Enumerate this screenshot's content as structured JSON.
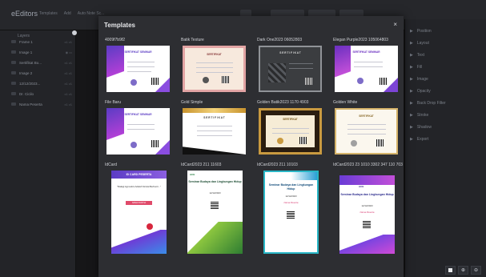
{
  "app": {
    "brand": "eEditors",
    "menu": [
      "Templates",
      "Add",
      "Auto Note Sc..."
    ]
  },
  "left_panel": {
    "title": "Layers",
    "layers": [
      {
        "label": "Frame 1",
        "meta": "x1  v1"
      },
      {
        "label": "Image 1",
        "meta": "◉  ▭"
      },
      {
        "label": "Sertifikat Bo...",
        "meta": "x1  v1"
      },
      {
        "label": "Image 2",
        "meta": "x1  v1"
      },
      {
        "label": "12/12/2023...",
        "meta": "x1  v1"
      },
      {
        "label": "Dr. Cicilo",
        "meta": "x1  v1"
      },
      {
        "label": "Nama Peserta",
        "meta": "x1  v1"
      }
    ]
  },
  "right_panel": {
    "items": [
      "Position",
      "Layout",
      "Text",
      "Fill",
      "Image",
      "Opacity",
      "Back Drop Filter",
      "Stroke",
      "Shadow",
      "Export"
    ]
  },
  "dialog": {
    "title": "Templates",
    "close_icon": "×",
    "templates": [
      {
        "name": "4009f7b9f2"
      },
      {
        "name": "Batik Texture"
      },
      {
        "name": "Dark One2023 06052803"
      },
      {
        "name": "Elegan Purple2023 105064803"
      },
      {
        "name": "File Baru"
      },
      {
        "name": "Gold Simple"
      },
      {
        "name": "Golden Batik2023 1170 4903"
      },
      {
        "name": "Golden White"
      },
      {
        "name": "IdCard"
      },
      {
        "name": "IdCard2023 211 11603"
      },
      {
        "name": "IdCard2023 211 10103"
      },
      {
        "name": "IdCard2023 23 1010 3302 347 110 703"
      }
    ],
    "cert_texts": {
      "sertifikat_seminar": "SERTIFIKAT SEMINAR",
      "sertifikat": "SERTIFIKAT",
      "sertifikat_spaced": "S E R T I F I K A T",
      "idcard_peserta": "ID CARD PESERTA",
      "idcard_sub": "\"Malagi Agnostics Adalah Sicolai Berhenti...\"",
      "idcard_name": "NAMA PANITIA",
      "seminar": "Seminar Budaya dan Lingkungan Hidup",
      "seminar_date": "12/12/2023",
      "seminar_name": "Nama Peserta",
      "brand_small": "ACE"
    }
  },
  "tools": [
    "■",
    "⊕",
    "⊖"
  ]
}
